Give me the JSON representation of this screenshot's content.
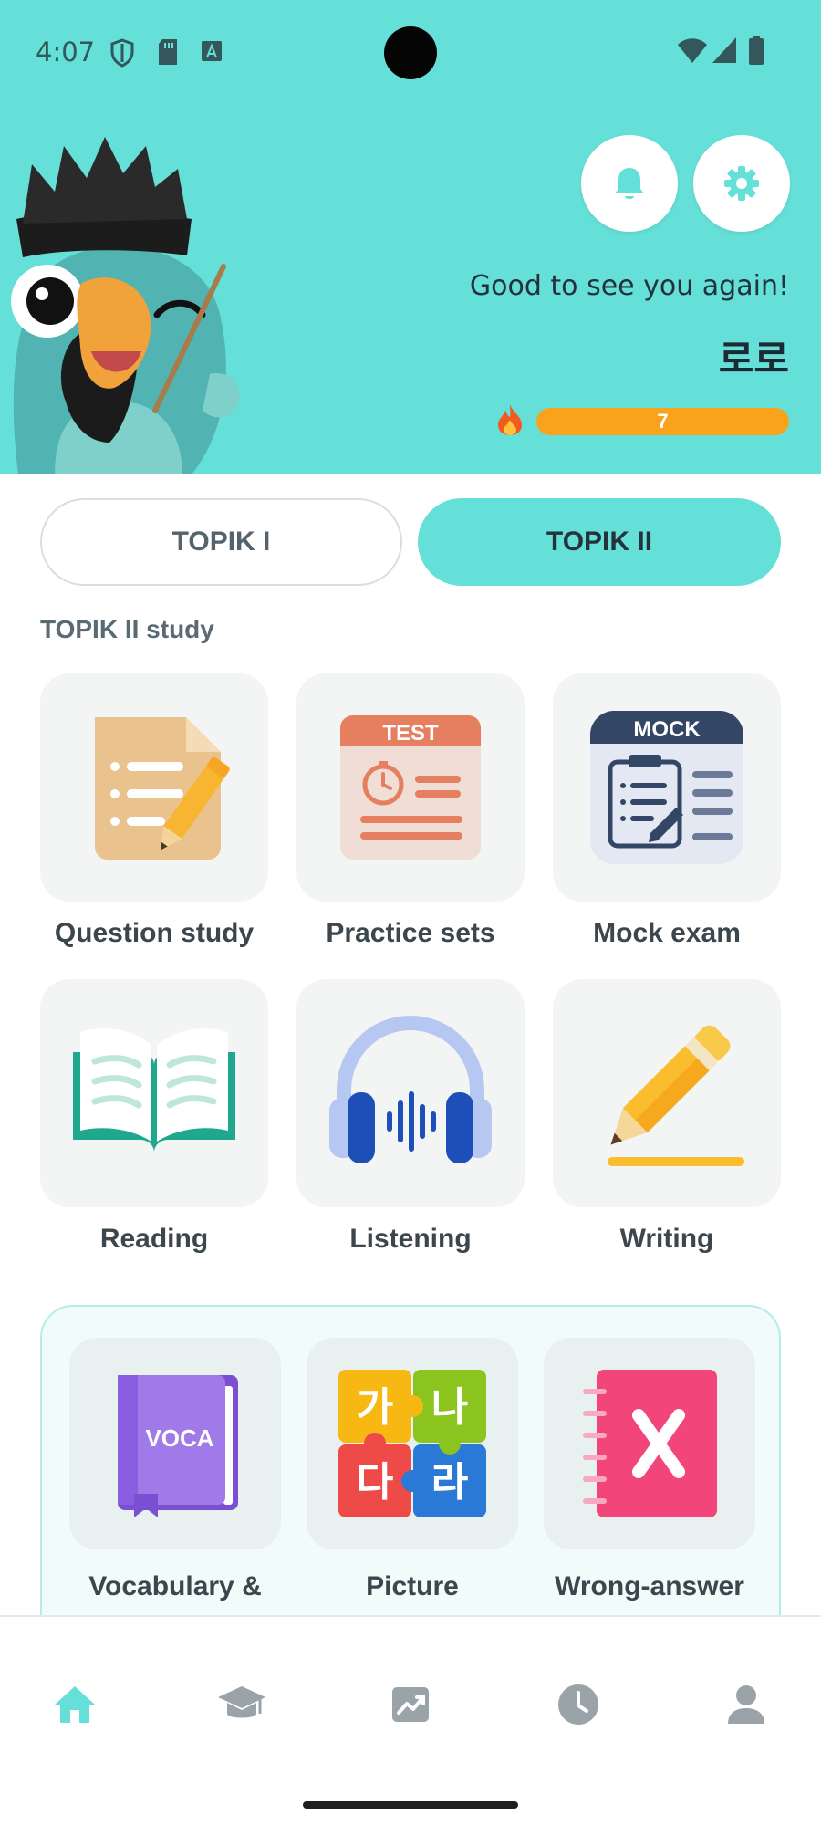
{
  "status_bar": {
    "time": "4:07"
  },
  "header": {
    "greeting": "Good to see you again!",
    "username": "로로",
    "streak_count": "7"
  },
  "levels": {
    "level_1": "TOPIK I",
    "level_2": "TOPIK II",
    "selected": "TOPIK II"
  },
  "study_section": {
    "title": "TOPIK II study",
    "items": [
      {
        "label": "Question study",
        "icon": "document-pencil-icon"
      },
      {
        "label": "Practice sets",
        "icon": "test-timer-icon"
      },
      {
        "label": "Mock exam",
        "icon": "mock-clipboard-icon"
      },
      {
        "label": "Reading",
        "icon": "open-book-icon"
      },
      {
        "label": "Listening",
        "icon": "headphones-icon"
      },
      {
        "label": "Writing",
        "icon": "pencil-icon"
      }
    ]
  },
  "practice_section": {
    "items": [
      {
        "label": "Vocabulary &",
        "icon": "voca-book-icon",
        "badge": "VOCA"
      },
      {
        "label": "Picture",
        "icon": "hangul-puzzle-icon",
        "glyphs": [
          "가",
          "나",
          "다",
          "라"
        ]
      },
      {
        "label": "Wrong-answer",
        "icon": "wrong-answer-notebook-icon"
      }
    ]
  },
  "icon_badges": {
    "test": "TEST",
    "mock": "MOCK"
  },
  "bottom_nav": {
    "items": [
      {
        "name": "home",
        "icon": "home-icon",
        "active": true
      },
      {
        "name": "study",
        "icon": "graduation-cap-icon",
        "active": false
      },
      {
        "name": "stats",
        "icon": "chart-icon",
        "active": false
      },
      {
        "name": "history",
        "icon": "clock-icon",
        "active": false
      },
      {
        "name": "profile",
        "icon": "person-icon",
        "active": false
      }
    ]
  },
  "colors": {
    "accent": "#65e0d8",
    "streak": "#f8a31b",
    "nav_active": "#65e0d8",
    "nav_inactive": "#9aa3a8"
  }
}
